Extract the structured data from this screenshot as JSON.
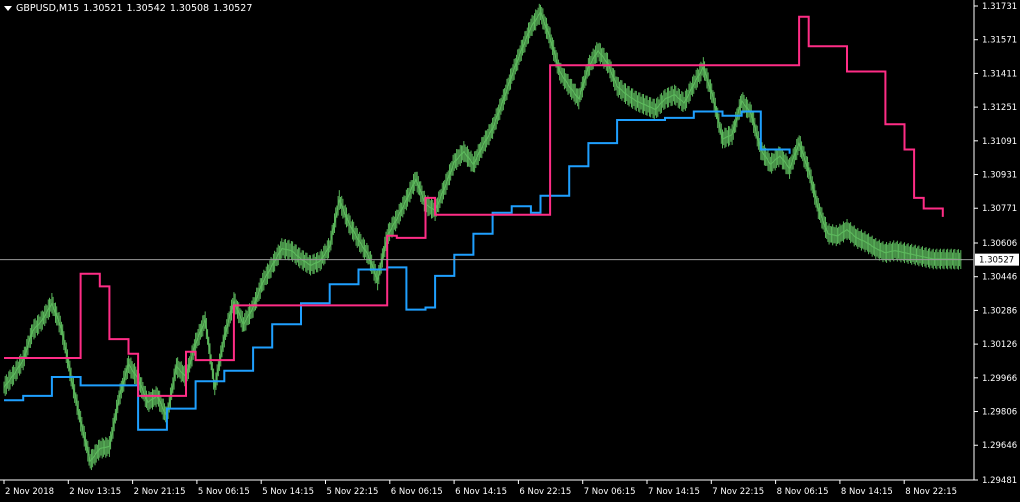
{
  "header": {
    "symbol": "GBPUSD,M15",
    "open": "1.30521",
    "high": "1.30542",
    "low": "1.30508",
    "close": "1.30527"
  },
  "chart_data": {
    "type": "line",
    "ylim": [
      1.29481,
      1.31731
    ],
    "y_ticks": [
      "1.31731",
      "1.31571",
      "1.31411",
      "1.31251",
      "1.31091",
      "1.30931",
      "1.30771",
      "1.30606",
      "1.30446",
      "1.30286",
      "1.30126",
      "1.29966",
      "1.29806",
      "1.29646",
      "1.29481"
    ],
    "x_ticks": [
      "2 Nov 2018",
      "2 Nov 13:15",
      "2 Nov 21:15",
      "5 Nov 06:15",
      "5 Nov 14:15",
      "5 Nov 22:15",
      "6 Nov 06:15",
      "6 Nov 14:15",
      "6 Nov 22:15",
      "7 Nov 06:15",
      "7 Nov 14:15",
      "7 Nov 22:15",
      "8 Nov 06:15",
      "8 Nov 14:15",
      "8 Nov 22:15"
    ],
    "current_price": 1.30527,
    "current_price_label": "1.30527",
    "series": [
      {
        "type": "bars",
        "color": "#5cb85c",
        "x": [
          0,
          0.01,
          0.02,
          0.03,
          0.04,
          0.05,
          0.06,
          0.07,
          0.08,
          0.09,
          0.1,
          0.11,
          0.12,
          0.13,
          0.14,
          0.15,
          0.16,
          0.17,
          0.18,
          0.19,
          0.2,
          0.21,
          0.22,
          0.23,
          0.24,
          0.25,
          0.26,
          0.27,
          0.28,
          0.29,
          0.3,
          0.31,
          0.32,
          0.33,
          0.34,
          0.35,
          0.36,
          0.37,
          0.38,
          0.39,
          0.4,
          0.41,
          0.42,
          0.43,
          0.44,
          0.45,
          0.46,
          0.47,
          0.48,
          0.49,
          0.5,
          0.51,
          0.52,
          0.53,
          0.54,
          0.55,
          0.56,
          0.57,
          0.58,
          0.59,
          0.6,
          0.61,
          0.62,
          0.63,
          0.64,
          0.65,
          0.66,
          0.67,
          0.68,
          0.69,
          0.7,
          0.71,
          0.72,
          0.73,
          0.74,
          0.75,
          0.76,
          0.77,
          0.78,
          0.79,
          0.8,
          0.81,
          0.82,
          0.83,
          0.84,
          0.85,
          0.86,
          0.87,
          0.88,
          0.89,
          0.9,
          0.91,
          0.92,
          0.93,
          0.94,
          0.95,
          0.96,
          0.97,
          0.98,
          0.99,
          1.0
        ],
        "y": [
          1.2992,
          1.2998,
          1.3005,
          1.3019,
          1.3024,
          1.3032,
          1.302,
          1.2997,
          1.2976,
          1.2957,
          1.2963,
          1.2964,
          1.2987,
          1.3003,
          1.2996,
          1.2985,
          1.2988,
          1.2978,
          1.3002,
          1.2997,
          1.3013,
          1.3024,
          1.2992,
          1.3016,
          1.3033,
          1.3022,
          1.303,
          1.3042,
          1.305,
          1.3058,
          1.3057,
          1.3053,
          1.305,
          1.3052,
          1.3059,
          1.3081,
          1.307,
          1.3062,
          1.3055,
          1.3043,
          1.3064,
          1.3072,
          1.3081,
          1.3091,
          1.3079,
          1.3076,
          1.3087,
          1.3099,
          1.3104,
          1.3098,
          1.3107,
          1.3115,
          1.3127,
          1.314,
          1.3152,
          1.3163,
          1.317,
          1.3158,
          1.3142,
          1.3135,
          1.3129,
          1.3144,
          1.3152,
          1.3146,
          1.3135,
          1.3131,
          1.3128,
          1.3126,
          1.3124,
          1.3129,
          1.3131,
          1.3127,
          1.3136,
          1.3144,
          1.313,
          1.311,
          1.3112,
          1.3128,
          1.3122,
          1.3105,
          1.3098,
          1.3102,
          1.3096,
          1.3108,
          1.3095,
          1.3077,
          1.3065,
          1.3064,
          1.3067,
          1.3063,
          1.3061,
          1.3058,
          1.3056,
          1.3057,
          1.3056,
          1.3055,
          1.3054,
          1.3053,
          1.3053,
          1.3053,
          1.30527
        ]
      },
      {
        "type": "step",
        "color": "#1fa0ff",
        "x": [
          0,
          0.02,
          0.05,
          0.08,
          0.14,
          0.17,
          0.2,
          0.23,
          0.26,
          0.28,
          0.31,
          0.34,
          0.37,
          0.4,
          0.42,
          0.44,
          0.45,
          0.47,
          0.49,
          0.51,
          0.53,
          0.55,
          0.56,
          0.59,
          0.61,
          0.64,
          0.66,
          0.69,
          0.71,
          0.72,
          0.73,
          0.75,
          0.77,
          0.79,
          0.8,
          0.82
        ],
        "y": [
          1.2986,
          1.2988,
          1.2997,
          1.2993,
          1.2972,
          1.2982,
          1.2995,
          1.3,
          1.3011,
          1.3022,
          1.3032,
          1.3041,
          1.3048,
          1.3049,
          1.3029,
          1.303,
          1.3045,
          1.3055,
          1.3065,
          1.3075,
          1.3078,
          1.3075,
          1.3083,
          1.3097,
          1.3108,
          1.3119,
          1.3119,
          1.312,
          1.312,
          1.3123,
          1.3123,
          1.3121,
          1.3123,
          1.3105,
          1.3105,
          1.3103
        ]
      },
      {
        "type": "step",
        "color": "#ff2d86",
        "x": [
          0.0,
          0.08,
          0.1,
          0.11,
          0.13,
          0.14,
          0.19,
          0.2,
          0.23,
          0.24,
          0.29,
          0.4,
          0.41,
          0.44,
          0.45,
          0.57,
          0.59,
          0.83,
          0.84,
          0.86,
          0.88,
          0.9,
          0.92,
          0.94,
          0.95,
          0.96,
          0.97,
          0.98
        ],
        "y": [
          1.3006,
          1.3046,
          1.304,
          1.3015,
          1.3008,
          1.2988,
          1.3009,
          1.3005,
          1.3005,
          1.3031,
          1.3031,
          1.3064,
          1.3063,
          1.3082,
          1.3074,
          1.3145,
          1.3145,
          1.3168,
          1.3154,
          1.3154,
          1.3142,
          1.3142,
          1.3117,
          1.3105,
          1.3082,
          1.3077,
          1.3077,
          1.3073
        ]
      }
    ]
  }
}
